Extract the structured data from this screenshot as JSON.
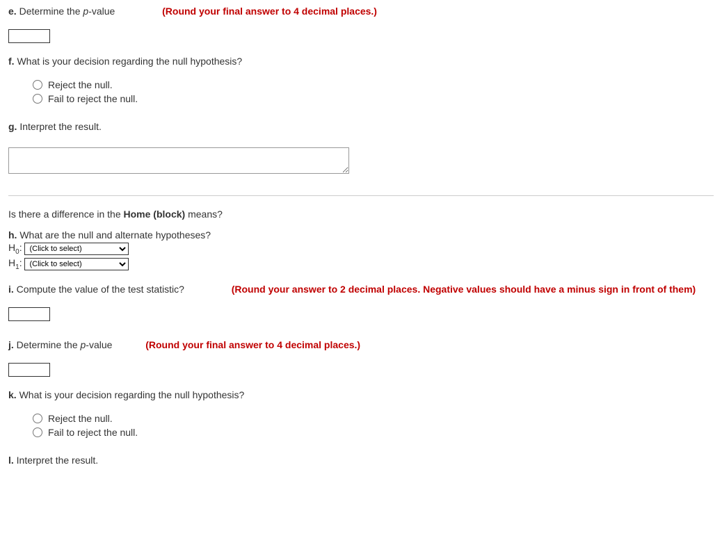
{
  "e": {
    "label": "e.",
    "text": "Determine the ",
    "italic": "p",
    "text2": "-value",
    "hint": "(Round your final answer to 4 decimal places.)"
  },
  "f": {
    "label": "f.",
    "text": "What is your decision regarding the null hypothesis?",
    "options": [
      "Reject the null.",
      "Fail to reject the null."
    ]
  },
  "g": {
    "label": "g.",
    "text": "Interpret the result."
  },
  "section2_intro": {
    "text1": "Is there a difference in the ",
    "bold": "Home (block)",
    "text2": " means?"
  },
  "h": {
    "label": "h.",
    "text": "What are the null and alternate hypotheses?",
    "h0_label": "H",
    "h0_sub": "0",
    "h1_label": "H",
    "h1_sub": "1",
    "select_placeholder": "(Click to select)"
  },
  "i": {
    "label": "i.",
    "text": "Compute the value of the test statistic?",
    "hint": "(Round your answer to 2 decimal places. Negative values should have a minus sign in front of them)"
  },
  "j": {
    "label": "j.",
    "text": "Determine the ",
    "italic": "p",
    "text2": "-value",
    "hint": "(Round your final answer to 4 decimal places.)"
  },
  "k": {
    "label": "k.",
    "text": "What is your decision regarding the null hypothesis?",
    "options": [
      "Reject the null.",
      "Fail to reject the null."
    ]
  },
  "l": {
    "label": "l.",
    "text": "Interpret the result."
  }
}
